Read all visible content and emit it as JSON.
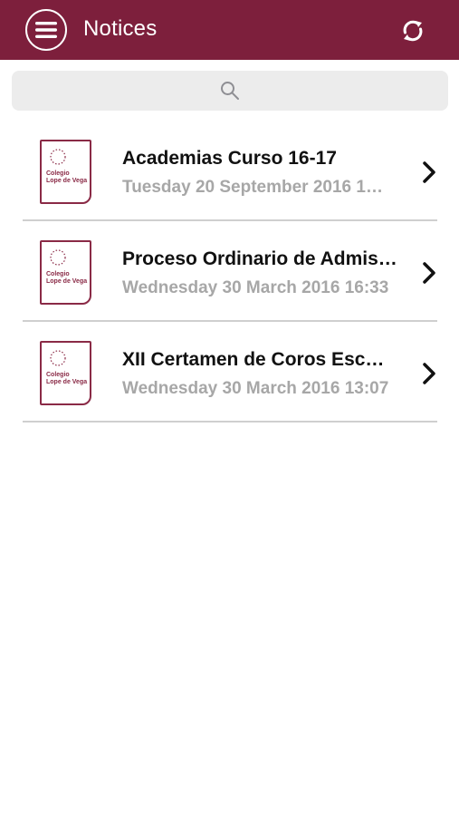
{
  "header": {
    "title": "Notices",
    "menu_icon": "hamburger-menu-icon",
    "refresh_icon": "refresh-icon",
    "background": "#7d1f3c"
  },
  "search": {
    "placeholder": "",
    "icon": "search-icon"
  },
  "notices": [
    {
      "title": "Academias Curso 16-17",
      "date": "Tuesday 20 September 2016 1…",
      "logo_text": [
        "Colegio",
        "Lope de Vega"
      ]
    },
    {
      "title": "Proceso Ordinario de Admis…",
      "date": "Wednesday 30 March 2016 16:33",
      "logo_text": [
        "Colegio",
        "Lope de Vega"
      ]
    },
    {
      "title": "XII Certamen de Coros Esc…",
      "date": "Wednesday 30 March 2016 13:07",
      "logo_text": [
        "Colegio",
        "Lope de Vega"
      ]
    }
  ]
}
